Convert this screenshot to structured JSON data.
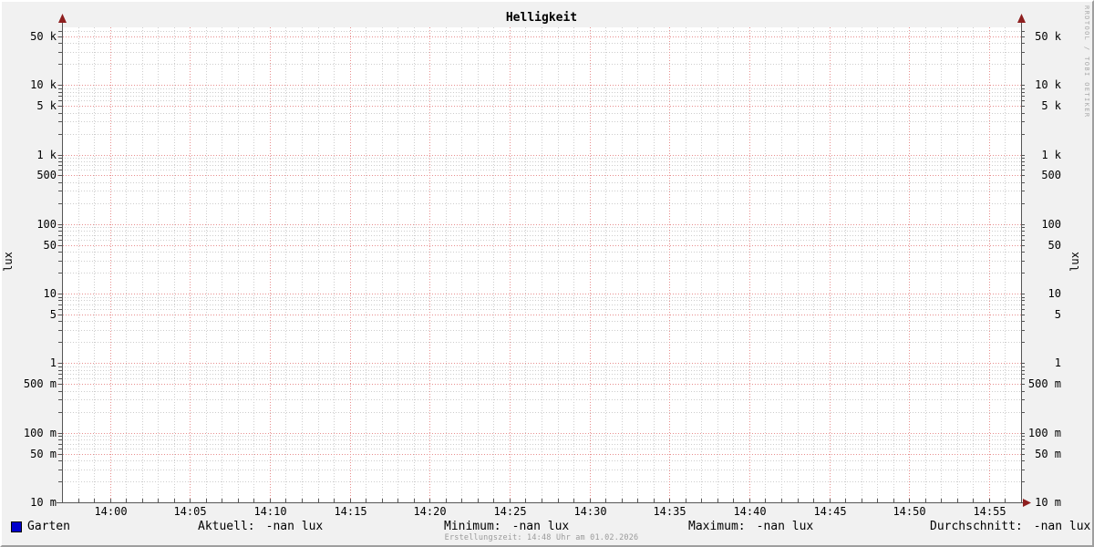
{
  "title": "Helligkeit",
  "watermark": "RRDTOOL / TOBI OETIKER",
  "legend": {
    "series_label": "Garten",
    "series_color": "#0000cd",
    "stats": [
      {
        "label": "Aktuell:",
        "value": "-nan lux"
      },
      {
        "label": "Minimum:",
        "value": "-nan lux"
      },
      {
        "label": "Maximum:",
        "value": "-nan lux"
      },
      {
        "label": "Durchschnitt:",
        "value": "-nan lux"
      }
    ]
  },
  "footer": {
    "creation": "Erstellungszeit: 14:48 Uhr am 01.02.2026"
  },
  "chart_data": {
    "type": "line",
    "title": "Helligkeit",
    "xlabel": "",
    "ylabel": "lux",
    "y_scale": "logarithmic",
    "ylim": [
      0.01,
      67000
    ],
    "y_major_ticks": [
      {
        "label": "50 k",
        "value": 50000
      },
      {
        "label": "10 k",
        "value": 10000
      },
      {
        "label": "5 k",
        "value": 5000
      },
      {
        "label": "1 k",
        "value": 1000
      },
      {
        "label": "500",
        "value": 500
      },
      {
        "label": "100",
        "value": 100
      },
      {
        "label": "50",
        "value": 50
      },
      {
        "label": "10",
        "value": 10
      },
      {
        "label": "5",
        "value": 5
      },
      {
        "label": "1",
        "value": 1
      },
      {
        "label": "500 m",
        "value": 0.5
      },
      {
        "label": "100 m",
        "value": 0.1
      },
      {
        "label": "50 m",
        "value": 0.05
      },
      {
        "label": "10 m",
        "value": 0.01
      }
    ],
    "y_minor_multiples": [
      2,
      3,
      4,
      6,
      7,
      8,
      9
    ],
    "x_start": "13:57",
    "x_end": "14:57",
    "x_major_tick_labels": [
      "14:00",
      "14:05",
      "14:10",
      "14:15",
      "14:20",
      "14:25",
      "14:30",
      "14:35",
      "14:40",
      "14:45",
      "14:50",
      "14:55"
    ],
    "x_major_step_minutes": 5,
    "x_minor_step_minutes": 1,
    "grid": true,
    "legend_position": "bottom",
    "series": [
      {
        "name": "Garten",
        "color": "#0000cd",
        "values": [],
        "note": "no data (-nan), plot area empty"
      }
    ],
    "colors": {
      "background": "#f1f1f1",
      "canvas": "#ffffff",
      "major_grid": "#e88e8e",
      "minor_grid": "#cdcdcd",
      "axis": "#565656",
      "arrow": "#8e1f1f",
      "text": "#000000",
      "muted_text": "#9a9a9a"
    }
  }
}
